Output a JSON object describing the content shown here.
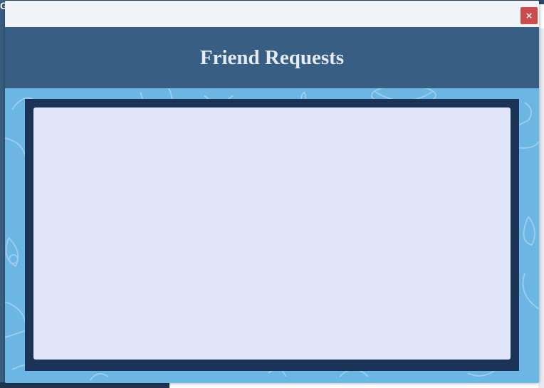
{
  "background": {
    "partial_letter": "G"
  },
  "modal": {
    "title": "Friend Requests",
    "close_label": "×",
    "requests": []
  },
  "colors": {
    "header": "#385e83",
    "body_pattern": "#6cb6e3",
    "frame": "#1c3358",
    "list": "#e1e6fa",
    "close_button": "#cc4b4b"
  }
}
